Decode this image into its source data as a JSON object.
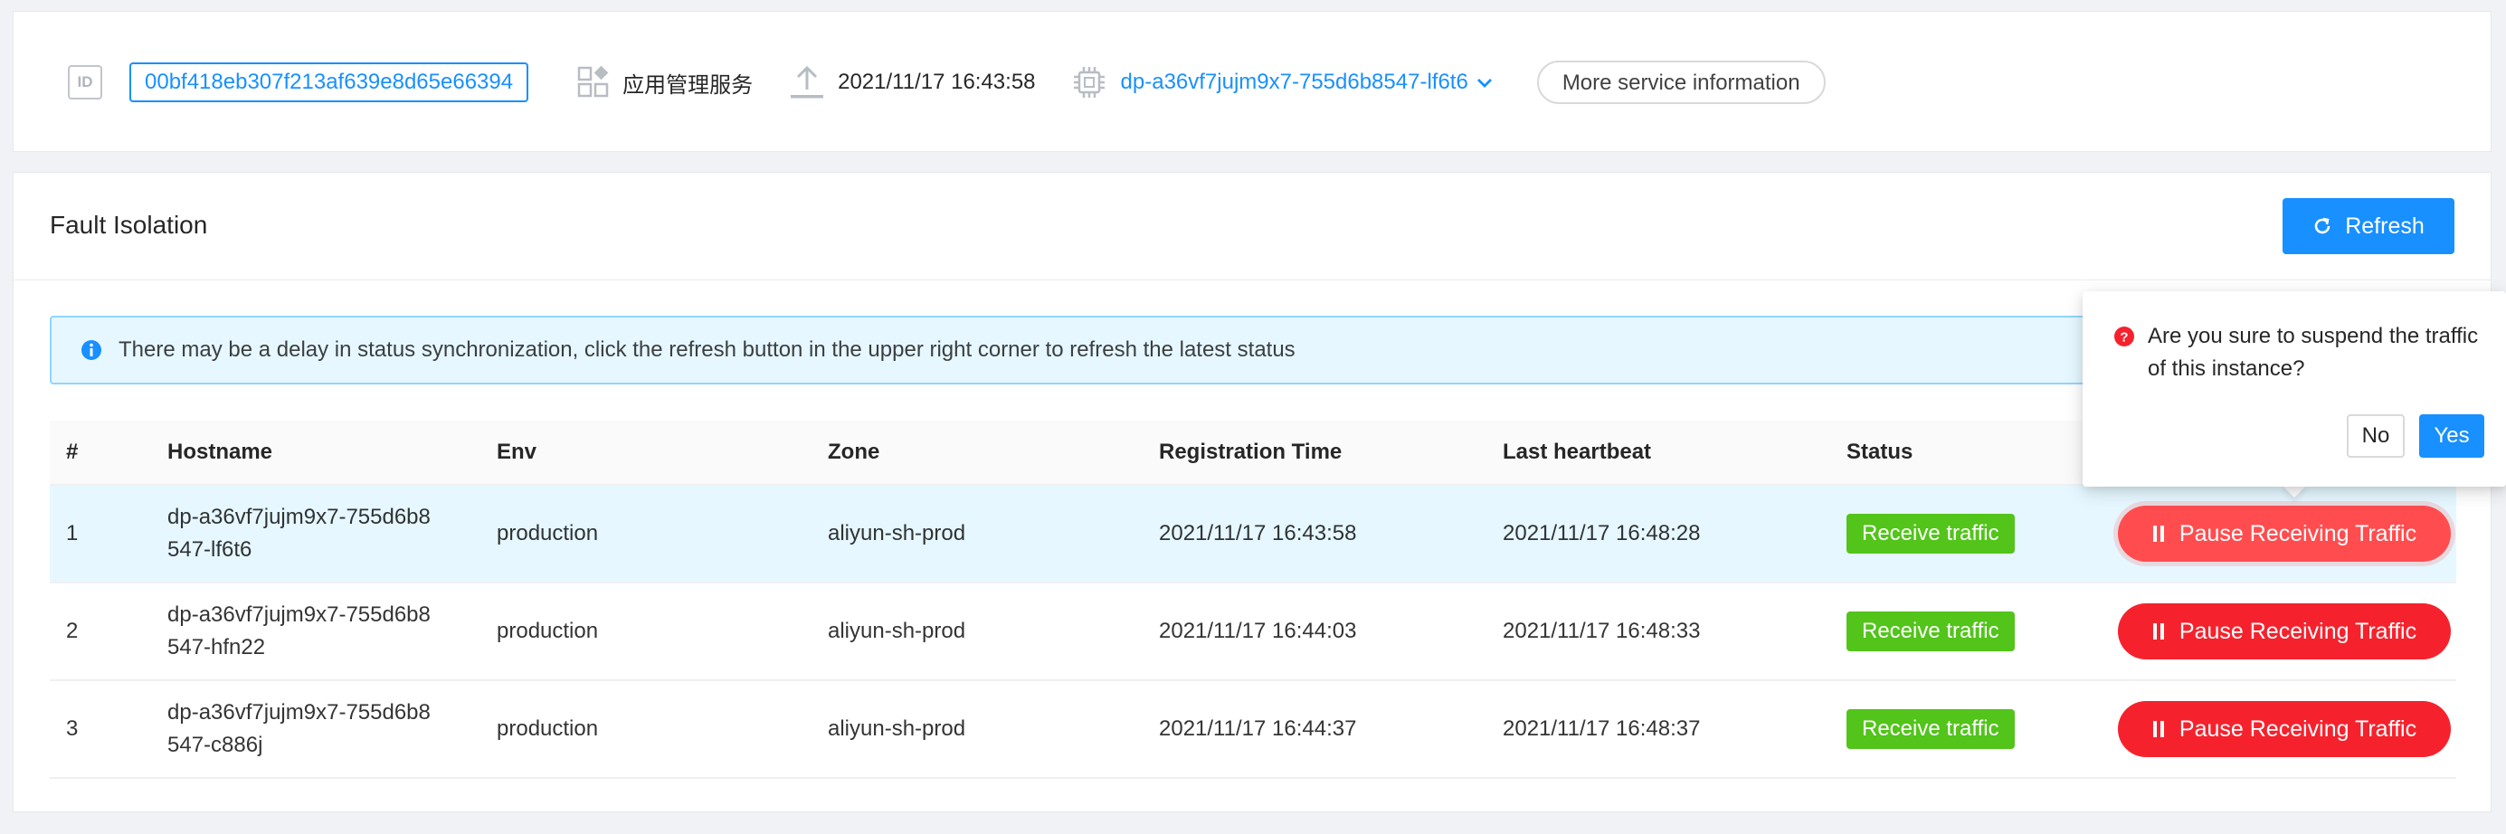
{
  "service": {
    "id_icon": "ID",
    "id_value": "00bf418eb307f213af639e8d65e66394",
    "app_name": "应用管理服务",
    "deploy_time": "2021/11/17 16:43:58",
    "host_select": "dp-a36vf7jujm9x7-755d6b8547-lf6t6",
    "more_button": "More service information",
    "icons": [
      "id-icon",
      "apps-icon",
      "upload-icon",
      "chip-icon",
      "chevron-down-icon"
    ]
  },
  "panel": {
    "title": "Fault Isolation",
    "refresh_label": "Refresh",
    "alert_text": "There may be a delay in status synchronization, click the refresh button in the upper right corner to refresh the latest status"
  },
  "table": {
    "columns": [
      "#",
      "Hostname",
      "Env",
      "Zone",
      "Registration Time",
      "Last heartbeat",
      "Status"
    ],
    "rows": [
      {
        "num": "1",
        "host_a": "dp-a36vf7jujm9x7-755d6b8",
        "host_b": "547-lf6t6",
        "env": "production",
        "zone": "aliyun-sh-prod",
        "reg": "2021/11/17 16:43:58",
        "hb": "2021/11/17 16:48:28",
        "status": "Receive traffic",
        "action": "Pause Receiving Traffic"
      },
      {
        "num": "2",
        "host_a": "dp-a36vf7jujm9x7-755d6b8",
        "host_b": "547-hfn22",
        "env": "production",
        "zone": "aliyun-sh-prod",
        "reg": "2021/11/17 16:44:03",
        "hb": "2021/11/17 16:48:33",
        "status": "Receive traffic",
        "action": "Pause Receiving Traffic"
      },
      {
        "num": "3",
        "host_a": "dp-a36vf7jujm9x7-755d6b8",
        "host_b": "547-c886j",
        "env": "production",
        "zone": "aliyun-sh-prod",
        "reg": "2021/11/17 16:44:37",
        "hb": "2021/11/17 16:48:37",
        "status": "Receive traffic",
        "action": "Pause Receiving Traffic"
      }
    ]
  },
  "popconfirm": {
    "message": "Are you sure to suspend the traffic of this instance?",
    "no_label": "No",
    "yes_label": "Yes"
  },
  "colors": {
    "primary": "#1890ff",
    "success": "#52c41a",
    "danger": "#f5222d",
    "alert_bg": "#e6f7ff"
  }
}
